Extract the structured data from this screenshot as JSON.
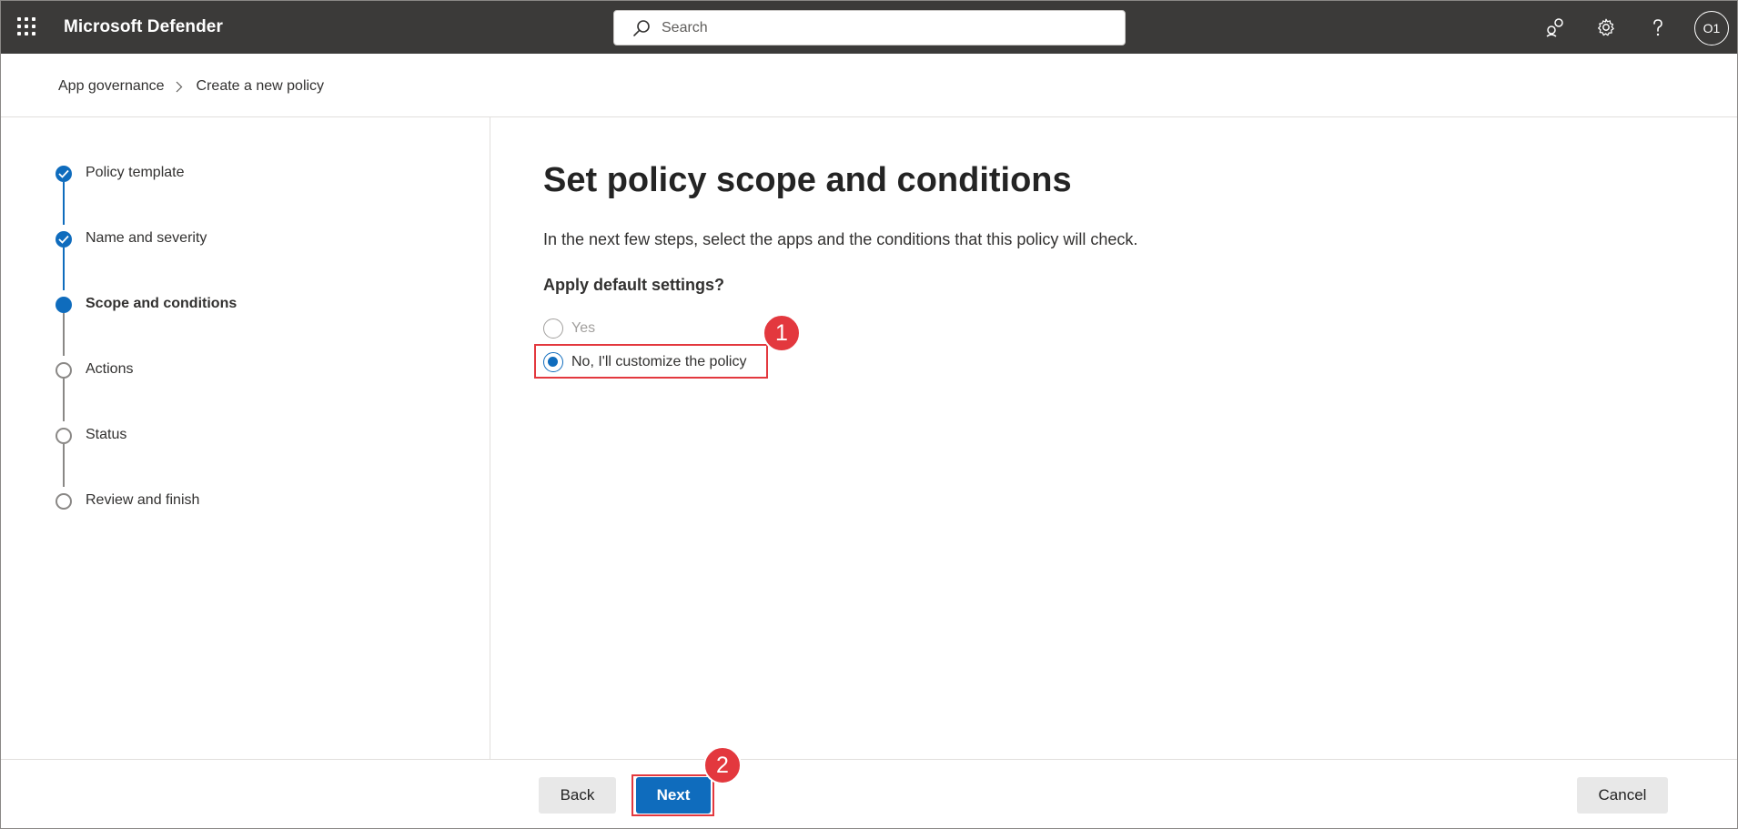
{
  "app": {
    "title": "Microsoft Defender"
  },
  "search": {
    "placeholder": "Search"
  },
  "topbar_icons": [
    "community-icon",
    "gear-icon",
    "help-icon"
  ],
  "user": {
    "initials": "O1"
  },
  "breadcrumb": {
    "items": [
      "App governance",
      "Create a new policy"
    ]
  },
  "steps": [
    {
      "label": "Policy template",
      "state": "done"
    },
    {
      "label": "Name and severity",
      "state": "done"
    },
    {
      "label": "Scope and conditions",
      "state": "current"
    },
    {
      "label": "Actions",
      "state": "todo"
    },
    {
      "label": "Status",
      "state": "todo"
    },
    {
      "label": "Review and finish",
      "state": "todo"
    }
  ],
  "main": {
    "title": "Set policy scope and conditions",
    "description": "In the next few steps, select the apps and the conditions that this policy will check.",
    "question": "Apply default settings?",
    "options": [
      {
        "label": "Yes",
        "selected": false,
        "disabled": true
      },
      {
        "label": "No, I'll customize the policy",
        "selected": true,
        "disabled": false
      }
    ]
  },
  "annotations": {
    "badge_1": "1",
    "badge_2": "2"
  },
  "footer": {
    "back_label": "Back",
    "next_label": "Next",
    "cancel_label": "Cancel"
  },
  "colors": {
    "accent": "#0f6cbd",
    "topbar": "#3b3a39",
    "annotation": "#e3383e"
  }
}
